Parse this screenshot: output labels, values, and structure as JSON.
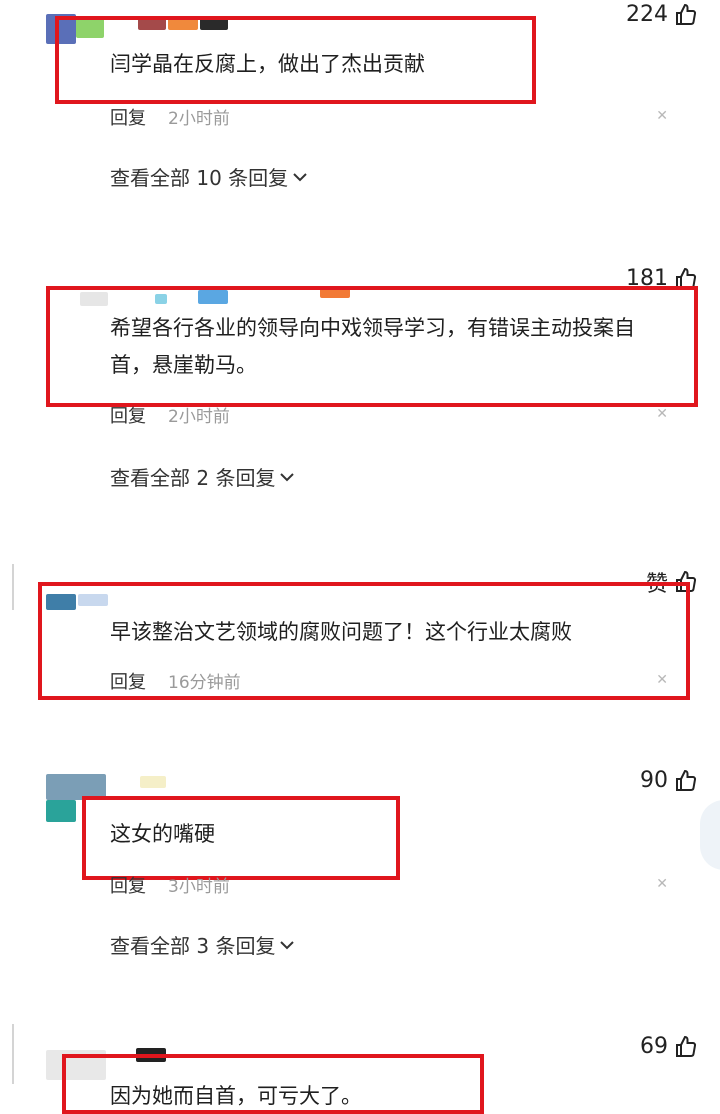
{
  "reply_label": "回复",
  "comments": [
    {
      "likes": "224",
      "text": "闫学晶在反腐上，做出了杰出贡献",
      "time": "2小时前",
      "replies": "查看全部 10 条回复"
    },
    {
      "likes": "181",
      "text": "希望各行各业的领导向中戏领导学习，有错误主动投案自首，悬崖勒马。",
      "time": "2小时前",
      "replies": "查看全部 2 条回复"
    },
    {
      "likes": "赞",
      "text": "早该整治文艺领域的腐败问题了！这个行业太腐败",
      "time": "16分钟前"
    },
    {
      "likes": "90",
      "text": "这女的嘴硬",
      "time": "3小时前",
      "replies": "查看全部 3 条回复"
    },
    {
      "likes": "69",
      "text": "因为她而自首，可亏大了。"
    }
  ],
  "colors": {
    "highlight": "#e0161d",
    "muted": "#9a9a9a"
  }
}
